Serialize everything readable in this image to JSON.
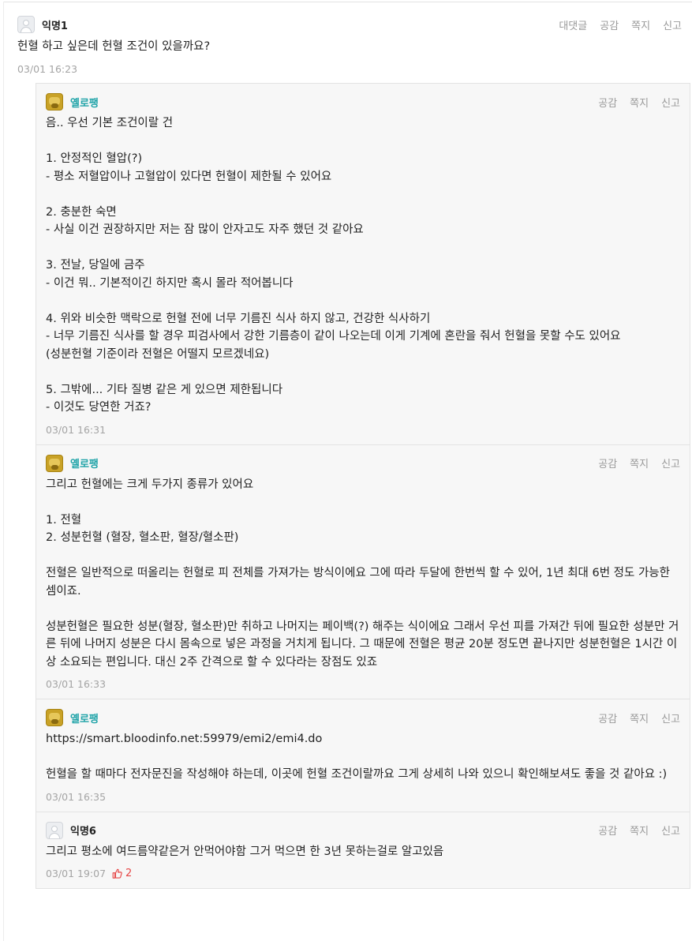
{
  "main": {
    "author": "익명1",
    "actions": [
      "대댓글",
      "공감",
      "쪽지",
      "신고"
    ],
    "content": "헌혈 하고 싶은데 헌혈 조건이 있을까요?",
    "time": "03/01 16:23"
  },
  "replies": [
    {
      "author": "옐로팽",
      "avatar": "cat-avatar",
      "actions": [
        "공감",
        "쪽지",
        "신고"
      ],
      "content": "음.. 우선 기본 조건이랄 건\n\n1. 안정적인 혈압(?)\n- 평소 저혈압이나 고혈압이 있다면 헌혈이 제한될 수 있어요\n\n2. 충분한 숙면\n- 사실 이건 권장하지만 저는 잠 많이 안자고도 자주 했던 것 같아요\n\n3. 전날, 당일에 금주\n- 이건 뭐.. 기본적이긴 하지만 혹시 몰라 적어봅니다\n\n4. 위와 비슷한 맥락으로 헌혈 전에 너무 기름진 식사 하지 않고, 건강한 식사하기\n- 너무 기름진 식사를 할 경우 피검사에서 강한 기름층이 같이 나오는데 이게 기계에 혼란을 줘서 헌혈을 못할 수도 있어요\n(성분헌혈 기준이라 전혈은 어떨지 모르겠네요)\n\n5. 그밖에... 기타 질병 같은 게 있으면 제한됩니다\n- 이것도 당연한 거죠?",
      "time": "03/01 16:31"
    },
    {
      "author": "옐로팽",
      "avatar": "cat-avatar",
      "actions": [
        "공감",
        "쪽지",
        "신고"
      ],
      "content": "그리고 헌혈에는 크게 두가지 종류가 있어요\n\n1. 전혈\n2. 성분헌혈 (혈장, 혈소판, 혈장/혈소판)\n\n전혈은 일반적으로 떠올리는 헌혈로 피 전체를 가져가는 방식이에요 그에 따라 두달에 한번씩 할 수 있어, 1년 최대 6번 정도 가능한 셈이죠.\n\n성분헌혈은 필요한 성분(혈장, 혈소판)만 취하고 나머지는 페이백(?) 해주는 식이에요 그래서 우선 피를 가져간 뒤에 필요한 성분만 거른 뒤에 나머지 성분은 다시 몸속으로 넣은 과정을 거치게 됩니다. 그 때문에 전혈은 평균 20분 정도면 끝나지만 성분헌혈은 1시간 이상 소요되는 편입니다. 대신 2주 간격으로 할 수 있다라는 장점도 있죠",
      "time": "03/01 16:33"
    },
    {
      "author": "옐로팽",
      "avatar": "cat-avatar",
      "actions": [
        "공감",
        "쪽지",
        "신고"
      ],
      "content": "https://smart.bloodinfo.net:59979/emi2/emi4.do\n\n헌혈을 할 때마다 전자문진을 작성해야 하는데, 이곳에 헌혈 조건이랄까요 그게 상세히 나와 있으니 확인해보셔도 좋을 것 같아요 :)",
      "time": "03/01 16:35"
    },
    {
      "author": "익명6",
      "avatar": "anon-avatar",
      "actions": [
        "공감",
        "쪽지",
        "신고"
      ],
      "content": "그리고 평소에 여드름약같은거 안먹어야함 그거 먹으면 한 3년 못하는걸로 알고있음",
      "time": "03/01 19:07",
      "likes": "2"
    }
  ],
  "colors": {
    "accent": "#1fa3a8",
    "like": "#e64545",
    "meta": "#a4a4a4"
  }
}
